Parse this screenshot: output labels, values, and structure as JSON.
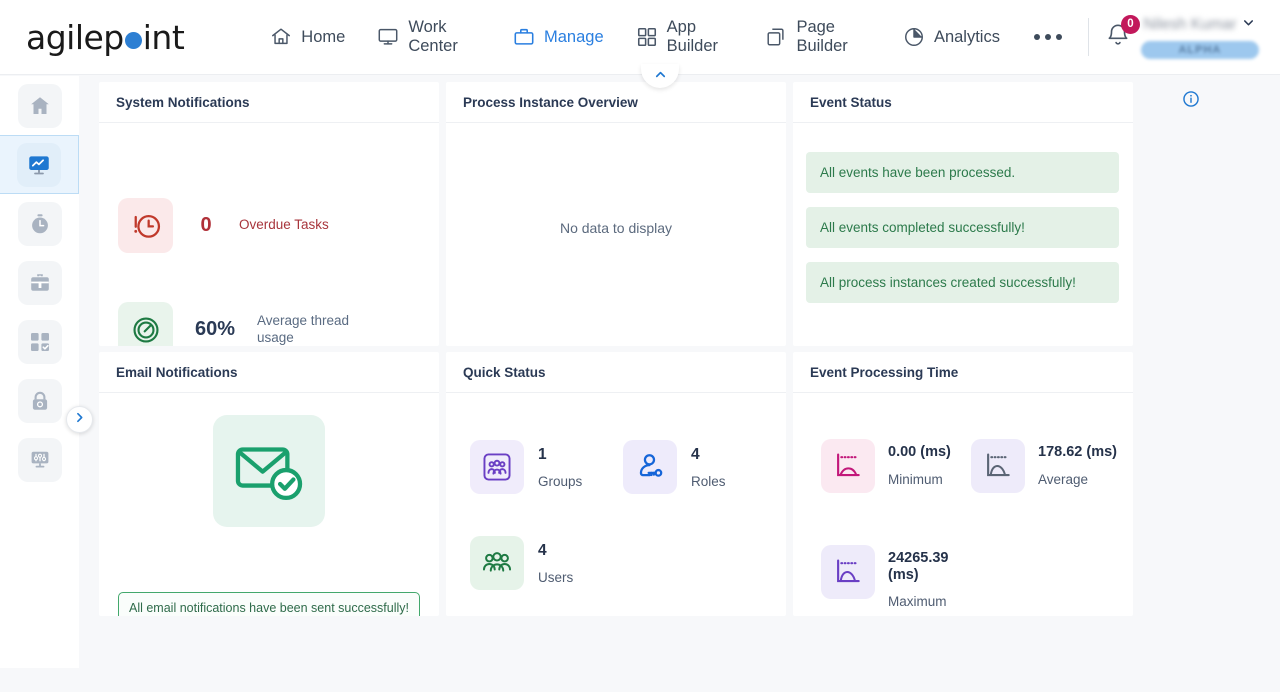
{
  "header": {
    "logo": {
      "part1": "agilep",
      "dot": "o-dot",
      "part2": "int"
    },
    "nav": [
      {
        "label": "Home",
        "icon": "home-icon",
        "active": false
      },
      {
        "label": "Work Center",
        "icon": "monitor-icon",
        "active": false
      },
      {
        "label": "Manage",
        "icon": "briefcase-icon",
        "active": true
      },
      {
        "label": "App Builder",
        "icon": "grid-squares-icon",
        "active": false
      },
      {
        "label": "Page Builder",
        "icon": "copy-pages-icon",
        "active": false
      },
      {
        "label": "Analytics",
        "icon": "pie-chart-icon",
        "active": false
      }
    ],
    "more_label": "more-options",
    "notification_count": "0",
    "user_name": "Nilesh Kumar",
    "tenant_badge": "ALPHA"
  },
  "rail": {
    "items": [
      {
        "name": "home",
        "icon": "home-icon",
        "active": false
      },
      {
        "name": "analytics",
        "icon": "monitor-chart-icon",
        "active": true
      },
      {
        "name": "history",
        "icon": "stopwatch-icon",
        "active": false
      },
      {
        "name": "portfolio",
        "icon": "briefcase-icon",
        "active": false
      },
      {
        "name": "apps",
        "icon": "grid-check-icon",
        "active": false
      },
      {
        "name": "access",
        "icon": "lock-icon",
        "active": false
      },
      {
        "name": "settings",
        "icon": "sliders-icon",
        "active": false
      }
    ],
    "expand_icon": "chevron-right-icon"
  },
  "main": {
    "collapse_icon": "chevron-up-icon",
    "info_icon": "info-circle-icon",
    "cards": {
      "system_notifications": {
        "title": "System Notifications",
        "stats": [
          {
            "value": "0",
            "label": "Overdue Tasks",
            "icon": "alert-clock-icon"
          },
          {
            "value": "60%",
            "label": "Average thread usage",
            "icon": "gauge-icon"
          }
        ]
      },
      "process_instance_overview": {
        "title": "Process Instance Overview",
        "empty_text": "No data to display"
      },
      "event_status": {
        "title": "Event Status",
        "messages": [
          "All events have been processed.",
          "All events completed successfully!",
          "All process instances created successfully!"
        ]
      },
      "email_notifications": {
        "title": "Email Notifications",
        "icon": "mail-check-icon",
        "message": "All email notifications have been sent successfully!"
      },
      "quick_status": {
        "title": "Quick Status",
        "items": [
          {
            "value": "1",
            "label": "Groups",
            "icon": "groups-icon"
          },
          {
            "value": "4",
            "label": "Roles",
            "icon": "role-key-icon"
          },
          {
            "value": "4",
            "label": "Users",
            "icon": "users-icon"
          }
        ]
      },
      "event_processing_time": {
        "title": "Event Processing Time",
        "items": [
          {
            "value": "0.00 (ms)",
            "label": "Minimum",
            "icon": "chart-min-icon"
          },
          {
            "value": "178.62 (ms)",
            "label": "Average",
            "icon": "chart-avg-icon"
          },
          {
            "value": "24265.39 (ms)",
            "label": "Maximum",
            "icon": "chart-max-icon"
          }
        ]
      }
    }
  },
  "colors": {
    "brand_blue": "#2a7fe0",
    "logo_dot": "#2d7fd3",
    "danger": "#b03038",
    "success": "#2c7a4b",
    "badge": "#c2185b"
  }
}
